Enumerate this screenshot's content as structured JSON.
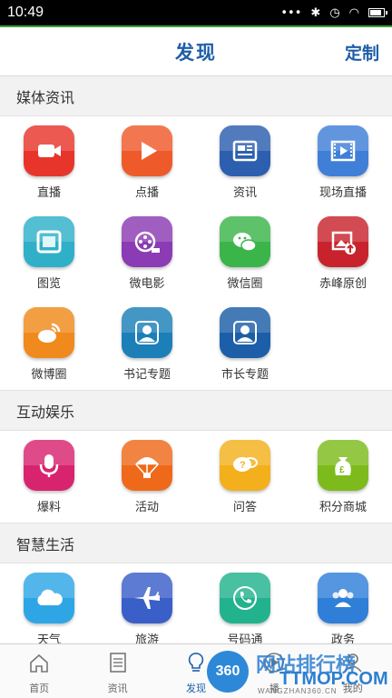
{
  "status_bar": {
    "time": "10:49"
  },
  "header": {
    "title": "发现",
    "action": "定制"
  },
  "sections": [
    {
      "title": "媒体资讯",
      "items": [
        {
          "label": "直播",
          "icon": "video-camera-icon",
          "color": "#e8352b"
        },
        {
          "label": "点播",
          "icon": "play-icon",
          "color": "#ef5a2a"
        },
        {
          "label": "资讯",
          "icon": "newspaper-icon",
          "color": "#2c5fb0"
        },
        {
          "label": "现场直播",
          "icon": "film-screen-icon",
          "color": "#3f7fd8"
        },
        {
          "label": "图览",
          "icon": "picture-icon",
          "color": "#2fb0c8"
        },
        {
          "label": "微电影",
          "icon": "film-reel-icon",
          "color": "#8b3bb3"
        },
        {
          "label": "微信圈",
          "icon": "wechat-icon",
          "color": "#3bb54a"
        },
        {
          "label": "赤峰原创",
          "icon": "image-upload-icon",
          "color": "#c8232c"
        },
        {
          "label": "微博圈",
          "icon": "weibo-icon",
          "color": "#f08a1c"
        },
        {
          "label": "书记专题",
          "icon": "person-icon",
          "color": "#1c7fb8"
        },
        {
          "label": "市长专题",
          "icon": "person-icon",
          "color": "#1c5fa8"
        }
      ]
    },
    {
      "title": "互动娱乐",
      "items": [
        {
          "label": "爆料",
          "icon": "microphone-icon",
          "color": "#d8246e"
        },
        {
          "label": "活动",
          "icon": "parachute-icon",
          "color": "#ee6a1a"
        },
        {
          "label": "问答",
          "icon": "chat-question-icon",
          "color": "#f3b01c"
        },
        {
          "label": "积分商城",
          "icon": "money-bag-icon",
          "color": "#7dbb1c"
        }
      ]
    },
    {
      "title": "智慧生活",
      "items": [
        {
          "label": "天气",
          "icon": "cloud-icon",
          "color": "#2ea6e6"
        },
        {
          "label": "旅游",
          "icon": "airplane-icon",
          "color": "#3a5fc8"
        },
        {
          "label": "号码通",
          "icon": "phone-icon",
          "color": "#22b28e"
        },
        {
          "label": "政务",
          "icon": "group-icon",
          "color": "#2f7fd8"
        }
      ]
    }
  ],
  "bottom_nav": [
    {
      "label": "首页",
      "icon": "home-icon"
    },
    {
      "label": "资讯",
      "icon": "document-icon"
    },
    {
      "label": "发现",
      "icon": "lightbulb-icon",
      "active": true
    },
    {
      "label": "播",
      "icon": "play-circle-icon"
    },
    {
      "label": "我的",
      "icon": "user-icon"
    }
  ],
  "watermark": {
    "badge": "360",
    "line1": "网站排行榜",
    "line2": "TTMOP.COM",
    "line3": "WANGZHAN360.CN"
  }
}
